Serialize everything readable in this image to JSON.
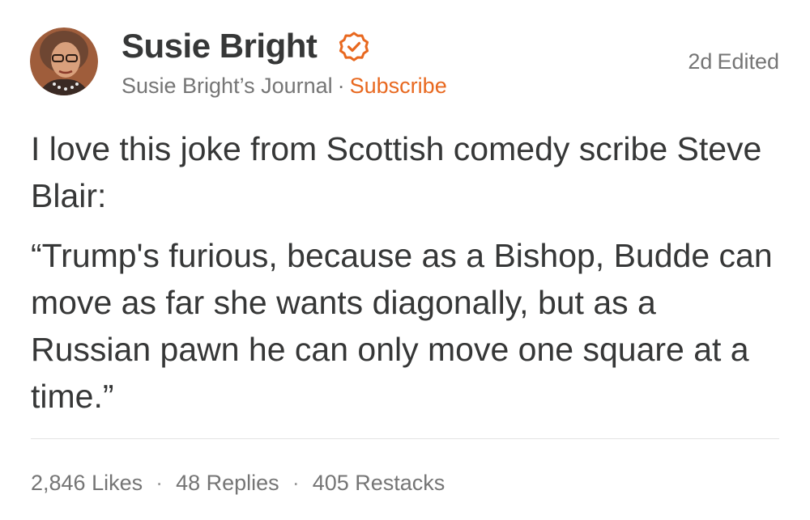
{
  "post": {
    "author": {
      "name": "Susie Bright",
      "publication": "Susie Bright’s Journal",
      "separator": "·",
      "subscribe_label": "Subscribe"
    },
    "meta": {
      "age": "2d",
      "edited_label": "Edited"
    },
    "body": {
      "paragraph_1": "I love this joke from Scottish comedy scribe Steve Blair:",
      "paragraph_2": "“Trump's furious, because as a Bishop, Budde can move as far she wants diagonally, but as a Russian pawn he can only move one square at a time.”"
    },
    "stats": {
      "likes": "2,846 Likes",
      "replies": "48 Replies",
      "restacks": "405 Restacks",
      "separator": "·"
    }
  },
  "colors": {
    "accent": "#e8681f",
    "text": "#363737",
    "muted": "#757575"
  },
  "icons": {
    "verified": "verified-badge-icon",
    "avatar": "avatar-photo"
  }
}
